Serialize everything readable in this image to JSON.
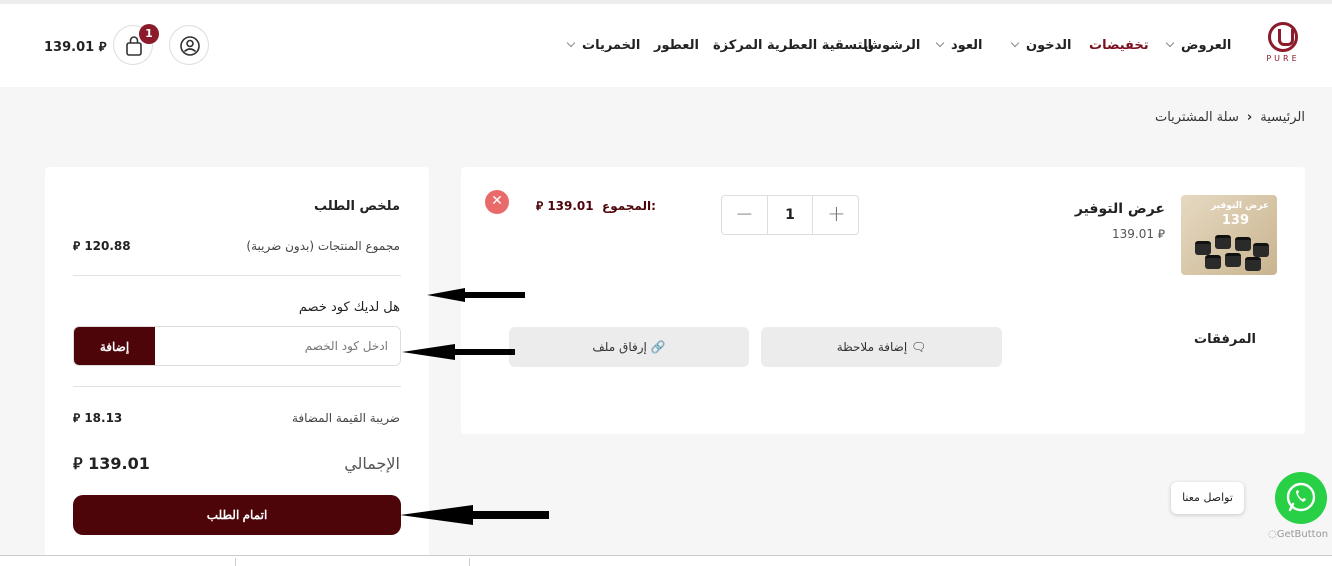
{
  "header": {
    "logo_text": "PURE",
    "nav": [
      {
        "label": "العروض",
        "has_dropdown": true
      },
      {
        "label": "تخفيضات",
        "has_dropdown": false,
        "highlight": true
      },
      {
        "label": "الدخون",
        "has_dropdown": true
      },
      {
        "label": "العود",
        "has_dropdown": true
      },
      {
        "label": "الرشوش",
        "has_dropdown": false
      },
      {
        "label": "التسقية العطرية المركزة",
        "has_dropdown": false
      },
      {
        "label": "العطور",
        "has_dropdown": false
      },
      {
        "label": "الخمريات",
        "has_dropdown": true
      }
    ],
    "cart_count": "1",
    "cart_total": "139.01",
    "currency_symbol": "⃁"
  },
  "breadcrumb": {
    "home": "الرئيسية",
    "current": "سلة المشتريات"
  },
  "cart_item": {
    "name": "عرض التوفير",
    "unit_price": "139.01",
    "quantity": "1",
    "total_label": "المجموع:",
    "total_value": "139.01",
    "thumb_title": "عرض التوفير",
    "thumb_price": "139",
    "attachments_label": "المرفقات",
    "add_note_label": "إضافة ملاحظة",
    "attach_file_label": "إرفاق ملف"
  },
  "summary": {
    "title": "ملخص الطلب",
    "subtotal_label": "مجموع المنتجات (بدون ضريبة)",
    "subtotal_value": "120.88",
    "coupon_question": "هل لديك كود خصم",
    "coupon_placeholder": "ادخل كود الخصم",
    "coupon_button": "إضافة",
    "vat_label": "ضريبة القيمة المضافة",
    "vat_value": "18.13",
    "total_label": "الإجمالي",
    "total_value": "139.01",
    "checkout_button": "اتمام الطلب"
  },
  "whatsapp": {
    "tooltip": "تواصل معنا",
    "credit": "GetButton"
  },
  "colors": {
    "brand": "#4d0509",
    "accent_red": "#8b1a2b",
    "whatsapp": "#27d045",
    "remove": "#e96a6a"
  }
}
